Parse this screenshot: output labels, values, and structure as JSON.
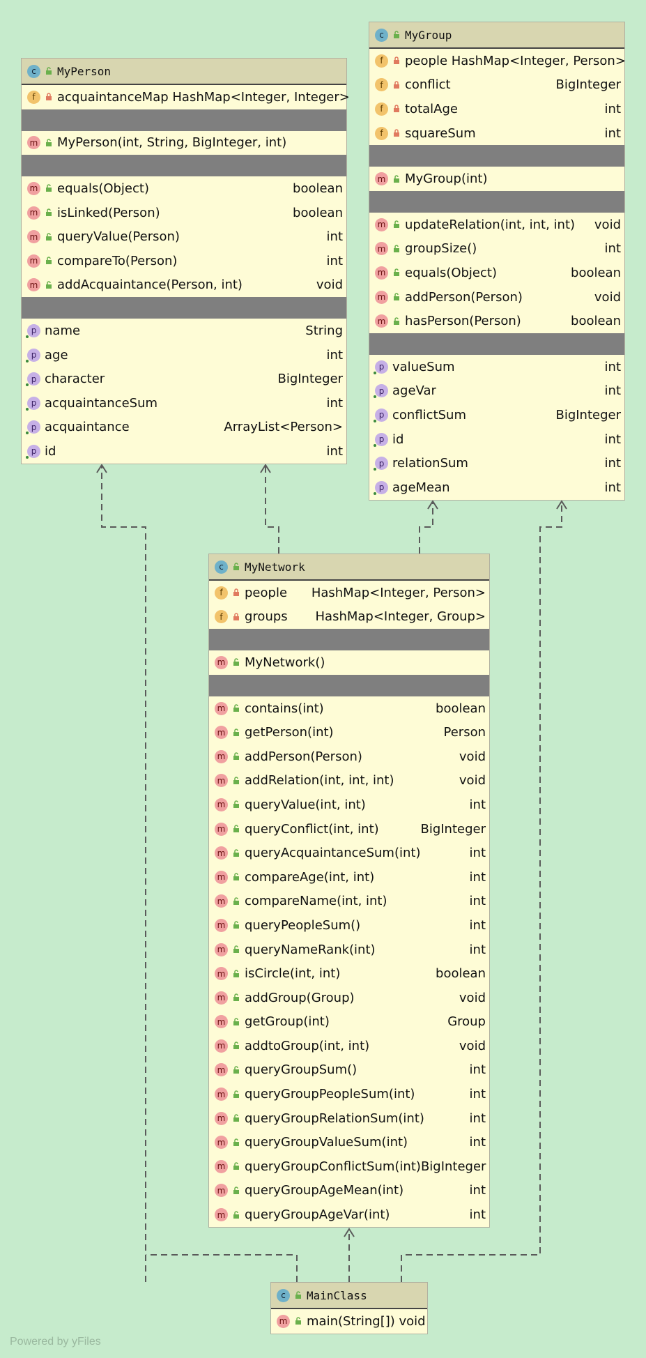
{
  "colors": {
    "background": "#c6ebcc",
    "box": "#fefcd6",
    "header": "#d8d6b0",
    "separator": "#7f7f7f",
    "edge": "#5a5a5a"
  },
  "classes": {
    "myperson": {
      "title": "MyPerson",
      "fields": [
        {
          "name": "acquaintanceMap HashMap<Integer, Integer>",
          "type": ""
        }
      ],
      "constructors": [
        {
          "name": "MyPerson(int, String, BigInteger, int)",
          "type": ""
        }
      ],
      "methods": [
        {
          "name": "equals(Object)",
          "type": "boolean"
        },
        {
          "name": "isLinked(Person)",
          "type": "boolean"
        },
        {
          "name": "queryValue(Person)",
          "type": "int"
        },
        {
          "name": "compareTo(Person)",
          "type": "int"
        },
        {
          "name": "addAcquaintance(Person, int)",
          "type": "void"
        }
      ],
      "properties": [
        {
          "name": "name",
          "type": "String"
        },
        {
          "name": "age",
          "type": "int"
        },
        {
          "name": "character",
          "type": "BigInteger"
        },
        {
          "name": "acquaintanceSum",
          "type": "int"
        },
        {
          "name": "acquaintance",
          "type": "ArrayList<Person>"
        },
        {
          "name": "id",
          "type": "int"
        }
      ]
    },
    "mygroup": {
      "title": "MyGroup",
      "fields": [
        {
          "name": "people HashMap<Integer, Person>",
          "type": ""
        },
        {
          "name": "conflict",
          "type": "BigInteger"
        },
        {
          "name": "totalAge",
          "type": "int"
        },
        {
          "name": "squareSum",
          "type": "int"
        }
      ],
      "constructors": [
        {
          "name": "MyGroup(int)",
          "type": ""
        }
      ],
      "methods": [
        {
          "name": "updateRelation(int, int, int)",
          "type": "void"
        },
        {
          "name": "groupSize()",
          "type": "int"
        },
        {
          "name": "equals(Object)",
          "type": "boolean"
        },
        {
          "name": "addPerson(Person)",
          "type": "void"
        },
        {
          "name": "hasPerson(Person)",
          "type": "boolean"
        }
      ],
      "properties": [
        {
          "name": "valueSum",
          "type": "int"
        },
        {
          "name": "ageVar",
          "type": "int"
        },
        {
          "name": "conflictSum",
          "type": "BigInteger"
        },
        {
          "name": "id",
          "type": "int"
        },
        {
          "name": "relationSum",
          "type": "int"
        },
        {
          "name": "ageMean",
          "type": "int"
        }
      ]
    },
    "mynetwork": {
      "title": "MyNetwork",
      "fields": [
        {
          "name": "people",
          "type": "HashMap<Integer, Person>"
        },
        {
          "name": "groups",
          "type": "HashMap<Integer, Group>"
        }
      ],
      "constructors": [
        {
          "name": "MyNetwork()",
          "type": ""
        }
      ],
      "methods": [
        {
          "name": "contains(int)",
          "type": "boolean"
        },
        {
          "name": "getPerson(int)",
          "type": "Person"
        },
        {
          "name": "addPerson(Person)",
          "type": "void"
        },
        {
          "name": "addRelation(int, int, int)",
          "type": "void"
        },
        {
          "name": "queryValue(int, int)",
          "type": "int"
        },
        {
          "name": "queryConflict(int, int)",
          "type": "BigInteger"
        },
        {
          "name": "queryAcquaintanceSum(int)",
          "type": "int"
        },
        {
          "name": "compareAge(int, int)",
          "type": "int"
        },
        {
          "name": "compareName(int, int)",
          "type": "int"
        },
        {
          "name": "queryPeopleSum()",
          "type": "int"
        },
        {
          "name": "queryNameRank(int)",
          "type": "int"
        },
        {
          "name": "isCircle(int, int)",
          "type": "boolean"
        },
        {
          "name": "addGroup(Group)",
          "type": "void"
        },
        {
          "name": "getGroup(int)",
          "type": "Group"
        },
        {
          "name": "addtoGroup(int, int)",
          "type": "void"
        },
        {
          "name": "queryGroupSum()",
          "type": "int"
        },
        {
          "name": "queryGroupPeopleSum(int)",
          "type": "int"
        },
        {
          "name": "queryGroupRelationSum(int)",
          "type": "int"
        },
        {
          "name": "queryGroupValueSum(int)",
          "type": "int"
        },
        {
          "name": "queryGroupConflictSum(int)",
          "type": "BigInteger"
        },
        {
          "name": "queryGroupAgeMean(int)",
          "type": "int"
        },
        {
          "name": "queryGroupAgeVar(int)",
          "type": "int"
        }
      ]
    },
    "mainclass": {
      "title": "MainClass",
      "methods": [
        {
          "name": "main(String[]) void",
          "type": ""
        }
      ]
    }
  },
  "watermark": "Powered by yFiles"
}
